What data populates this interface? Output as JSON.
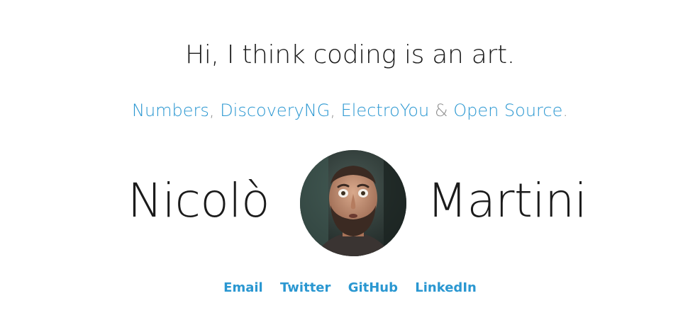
{
  "hero": {
    "tagline": "Hi, I think coding is an art."
  },
  "projects": {
    "items": [
      "Numbers",
      "DiscoveryNG",
      "ElectroYou",
      "Open Source"
    ],
    "comma": ",",
    "ampersand": "&",
    "period": "."
  },
  "name": {
    "first": "Nicolò",
    "last": "Martini"
  },
  "avatar": {
    "icon": "portrait-photo"
  },
  "social": {
    "links": [
      "Email",
      "Twitter",
      "GitHub",
      "LinkedIn"
    ]
  },
  "colors": {
    "link": "#2a97d1",
    "muted": "#8f8f8f",
    "text": "#1b1b1b"
  }
}
